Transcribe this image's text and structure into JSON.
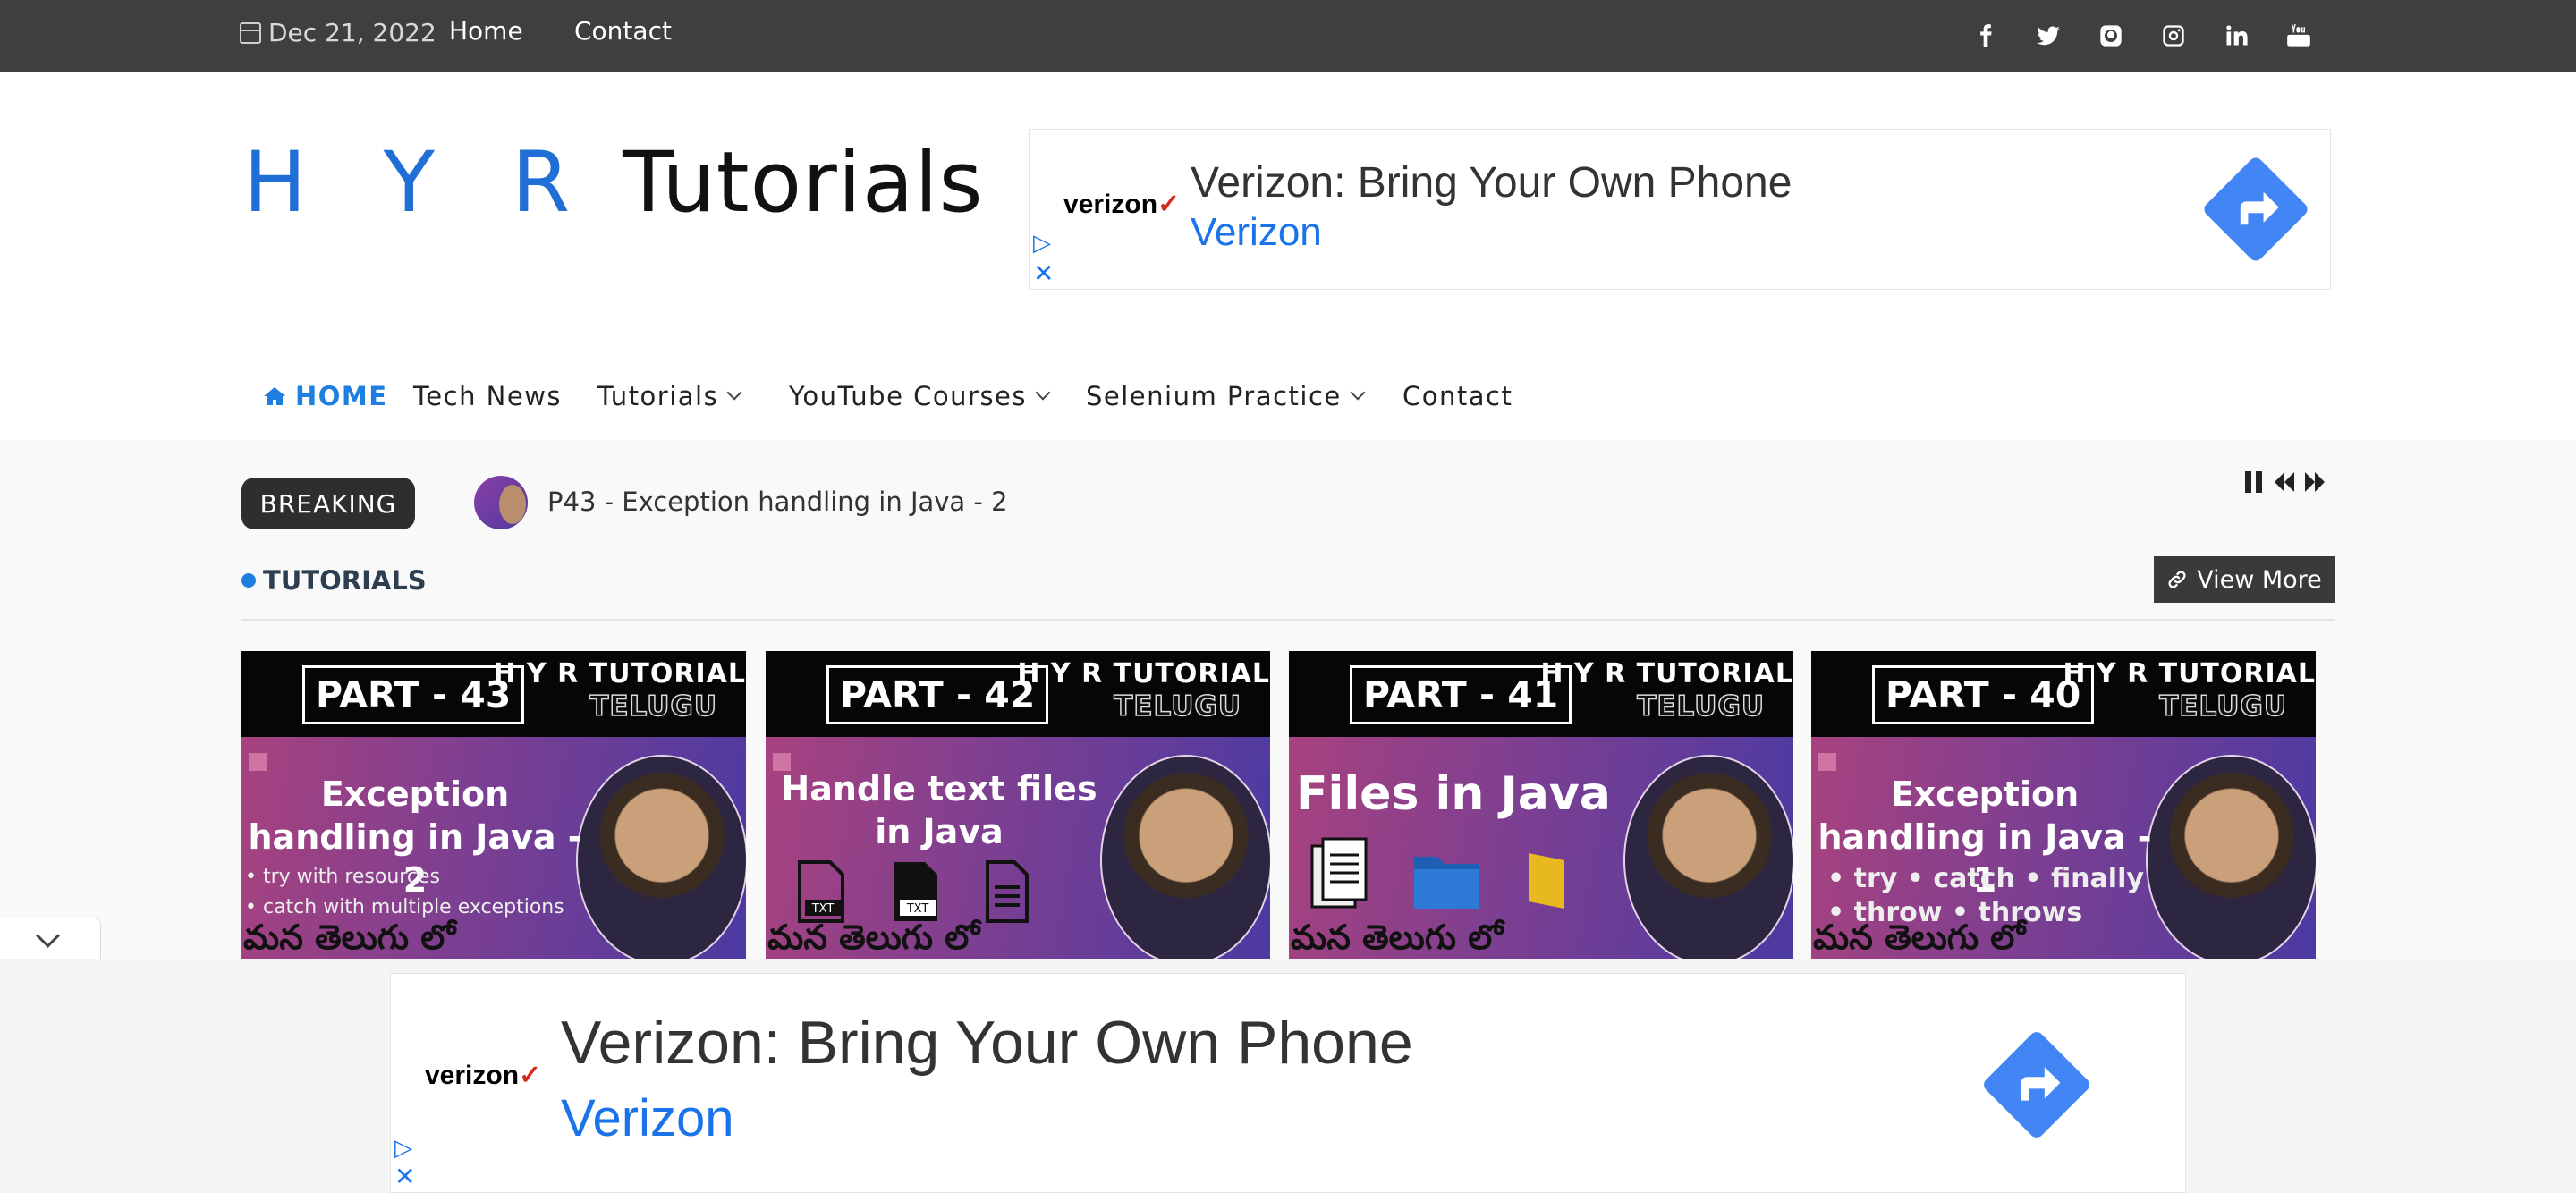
{
  "topbar": {
    "date": "Dec 21, 2022",
    "links": [
      "Home",
      "Contact"
    ],
    "social_icons": [
      "facebook-icon",
      "twitter-icon",
      "github-icon",
      "instagram-icon",
      "linkedin-icon",
      "youtube-icon"
    ]
  },
  "logo": {
    "part1": "H Y R",
    "part2": " Tutorials"
  },
  "ad_top": {
    "advertiser_logo": "verizon",
    "title": "Verizon: Bring Your Own Phone",
    "brand": "Verizon"
  },
  "nav": {
    "items": [
      {
        "label": "HOME",
        "active": true,
        "dropdown": false
      },
      {
        "label": "Tech News",
        "dropdown": false
      },
      {
        "label": "Tutorials",
        "dropdown": true
      },
      {
        "label": "YouTube Courses",
        "dropdown": true
      },
      {
        "label": "Selenium Practice",
        "dropdown": true
      },
      {
        "label": "Contact",
        "dropdown": false
      }
    ]
  },
  "breaking": {
    "label": "BREAKING",
    "headline": "P43 - Exception handling in Java - 2"
  },
  "section": {
    "title": "TUTORIALS",
    "view_more": "View More"
  },
  "cards": [
    {
      "part": "PART - 43",
      "brand": "H Y R TUTORIAL",
      "lang": "TELUGU",
      "headline": "Exception handling in Java - 2",
      "bullets": [
        "• try with resources",
        "• catch with multiple exceptions"
      ],
      "footer": "మన తెలుగు లో"
    },
    {
      "part": "PART - 42",
      "brand": "H Y R TUTORIAL",
      "lang": "TELUGU",
      "headline": "Handle text files in Java",
      "bullets": [],
      "footer": "మన తెలుగు లో"
    },
    {
      "part": "PART - 41",
      "brand": "H Y R TUTORIAL",
      "lang": "TELUGU",
      "headline": "Files in Java",
      "bullets": [],
      "footer": "మన తెలుగు లో"
    },
    {
      "part": "PART - 40",
      "brand": "H Y R TUTORIAL",
      "lang": "TELUGU",
      "headline": "Exception handling in Java - 1",
      "bullets": [
        "• try  • catch  • finally",
        "• throw  • throws"
      ],
      "footer": "మన తెలుగు లో"
    }
  ],
  "ad_bottom": {
    "advertiser_logo": "verizon",
    "title": "Verizon: Bring Your Own Phone",
    "brand": "Verizon"
  },
  "colors": {
    "topbar_bg": "#3f3f3f",
    "accent": "#1f7fe0",
    "ad_button": "#4285f4",
    "ad_brand": "#1a73e8"
  }
}
